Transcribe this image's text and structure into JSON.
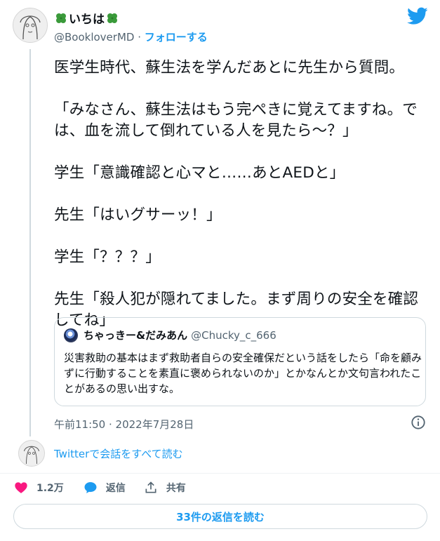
{
  "author": {
    "display_name": "いちは",
    "name_prefix_icon": "four-leaf-clover-icon",
    "name_suffix_icon": "four-leaf-clover-icon",
    "handle": "@BookloverMD",
    "separator": "·",
    "follow_label": "フォローする"
  },
  "tweet": {
    "text": "医学生時代、蘇生法を学んだあとに先生から質問。\n\n「みなさん、蘇生法はもう完ぺきに覚えてますね。では、血を流して倒れている人を見たら～？」\n\n学生「意識確認と心マと……あとAEDと」\n\n先生「はいグサーッ！」\n\n学生「？？？」\n\n先生「殺人犯が隠れてました。まず周りの安全を確認してね」",
    "timestamp": "午前11:50 · 2022年7月28日"
  },
  "quoted": {
    "display_name": "ちゃっきー&だみあん",
    "handle": "@Chucky_c_666",
    "text": "災害救助の基本はまず救助者自らの安全確保だという話をしたら「命を顧みずに行動することを素直に褒められないのか」とかなんとか文句言われたことがあるの思い出すな。"
  },
  "conversation_link": "Twitterで会話をすべて読む",
  "actions": {
    "likes": "1.2万",
    "reply_label": "返信",
    "share_label": "共有"
  },
  "read_replies_label": "33件の返信を読む",
  "colors": {
    "accent": "#1d9bf0",
    "like": "#f91880",
    "secondary_text": "#536471",
    "border": "#cfd9de"
  }
}
